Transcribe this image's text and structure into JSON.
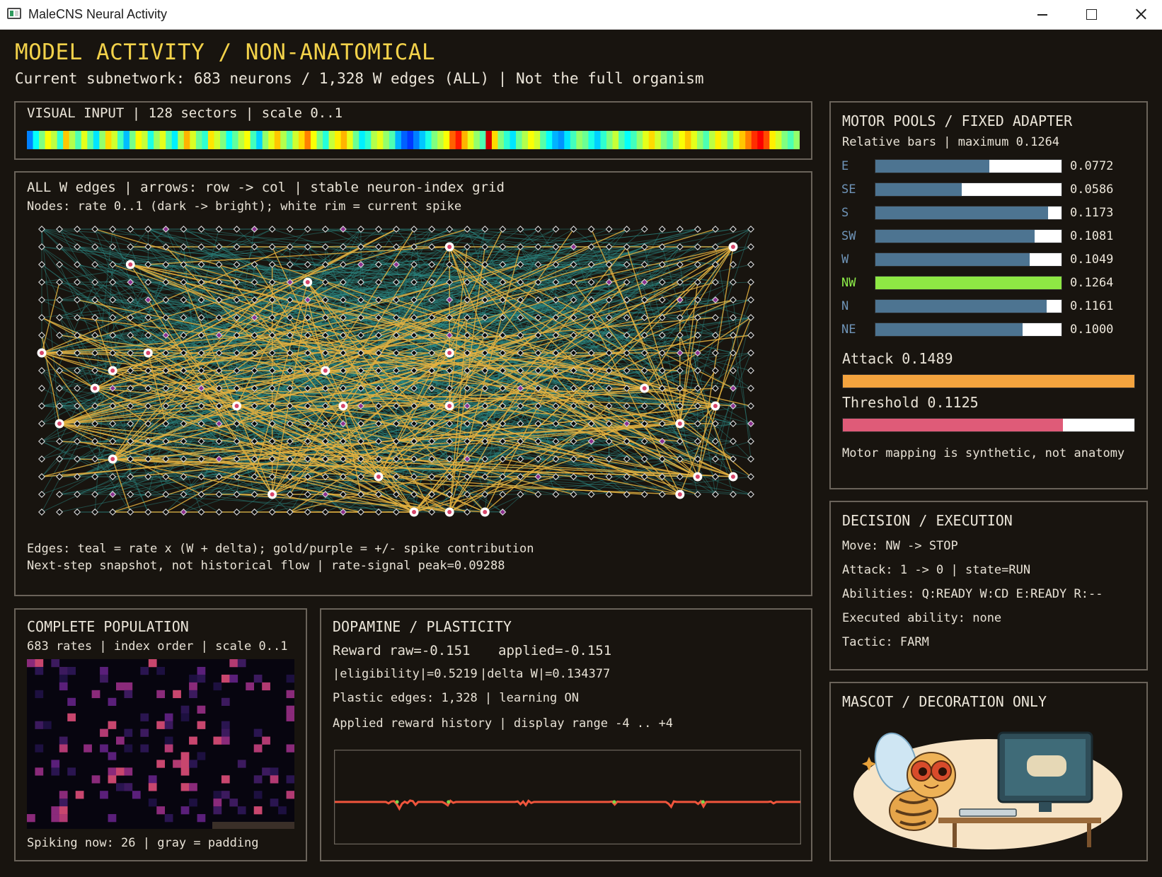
{
  "window": {
    "title": "MaleCNS Neural Activity"
  },
  "header": {
    "title": "MODEL ACTIVITY / NON-ANATOMICAL",
    "subtitle": "Current subnetwork: 683 neurons / 1,328 W edges (ALL) | Not the full organism"
  },
  "visual_input": {
    "title": "VISUAL INPUT | 128 sectors | scale 0..1",
    "sector_values": [
      0.25,
      0.38,
      0.5,
      0.62,
      0.56,
      0.42,
      0.68,
      0.55,
      0.45,
      0.6,
      0.47,
      0.35,
      0.52,
      0.66,
      0.58,
      0.44,
      0.31,
      0.49,
      0.63,
      0.57,
      0.4,
      0.53,
      0.6,
      0.46,
      0.36,
      0.55,
      0.7,
      0.59,
      0.48,
      0.42,
      0.65,
      0.58,
      0.5,
      0.38,
      0.47,
      0.56,
      0.62,
      0.44,
      0.33,
      0.52,
      0.6,
      0.68,
      0.55,
      0.46,
      0.58,
      0.66,
      0.75,
      0.62,
      0.5,
      0.41,
      0.57,
      0.64,
      0.7,
      0.6,
      0.48,
      0.36,
      0.42,
      0.55,
      0.6,
      0.52,
      0.45,
      0.3,
      0.22,
      0.18,
      0.25,
      0.32,
      0.4,
      0.5,
      0.56,
      0.62,
      0.78,
      0.85,
      0.7,
      0.6,
      0.52,
      0.45,
      0.92,
      0.66,
      0.5,
      0.42,
      0.35,
      0.48,
      0.55,
      0.62,
      0.58,
      0.46,
      0.38,
      0.3,
      0.27,
      0.35,
      0.44,
      0.52,
      0.48,
      0.4,
      0.33,
      0.42,
      0.5,
      0.57,
      0.45,
      0.38,
      0.44,
      0.52,
      0.6,
      0.66,
      0.58,
      0.5,
      0.45,
      0.55,
      0.62,
      0.68,
      0.6,
      0.52,
      0.45,
      0.56,
      0.64,
      0.58,
      0.5,
      0.6,
      0.68,
      0.75,
      0.83,
      0.88,
      0.8,
      0.64,
      0.58,
      0.5,
      0.45,
      0.52
    ]
  },
  "graph": {
    "line1": "ALL W edges | arrows: row -> col | stable neuron-index grid",
    "line2": "Nodes: rate 0..1 (dark -> bright); white rim = current spike",
    "footer1": "Edges: teal = rate x (W + delta); gold/purple = +/- spike contribution",
    "footer2": "Next-step snapshot, not historical flow | rate-signal peak=0.09288",
    "edge_colors": {
      "rate": "#2c8f8a",
      "positive_spike": "#e4b23f",
      "negative_spike": "#8c3ea8"
    }
  },
  "population": {
    "title": "COMPLETE POPULATION",
    "subtitle": "683 rates | index order | scale 0..1",
    "footer": "Spiking now: 26 | gray = padding"
  },
  "dopamine": {
    "title": "DOPAMINE / PLASTICITY",
    "reward_raw": "Reward raw=-0.151",
    "reward_applied": "applied=-0.151",
    "eligibility": "|eligibility|=0.5219",
    "delta_w": "|delta W|=0.134377",
    "plastic_edges": "Plastic edges: 1,328 | learning ON",
    "history_label": "Applied reward history | display range -4 .. +4",
    "history_range": [
      -4,
      4
    ],
    "history_values": [
      0.02,
      0.02,
      0.02,
      0.02,
      0.02,
      0.02,
      0.02,
      0.02,
      0.02,
      0.02,
      0.02,
      0.02,
      0.02,
      0.02,
      0.02,
      0.02,
      0.02,
      0.02,
      0.02,
      0.02,
      -0.08,
      0.05,
      0.08,
      -0.12,
      -0.45,
      -0.1,
      0.04,
      -0.06,
      0.12,
      0.08,
      -0.18,
      0.02,
      0.02,
      0.02,
      0.02,
      0.02,
      0.02,
      0.02,
      0.02,
      0.02,
      0.02,
      -0.08,
      -0.22,
      0.1,
      -0.04,
      0.02,
      0.02,
      0.02,
      0.02,
      0.02,
      0.02,
      0.02,
      0.02,
      0.02,
      0.02,
      0.02,
      0.02,
      0.02,
      0.02,
      0.02,
      0.02,
      0.02,
      0.02,
      0.02,
      0.02,
      0.02,
      0.02,
      0.02,
      0.06,
      -0.14,
      0.05,
      -0.2,
      0.1,
      -0.05,
      0.02,
      0.02,
      0.02,
      0.02,
      0.02,
      0.02,
      0.02,
      0.02,
      0.02,
      0.02,
      0.02,
      0.02,
      0.02,
      0.02,
      0.02,
      0.02,
      0.02,
      0.02,
      0.02,
      0.02,
      0.02,
      0.02,
      0.02,
      0.02,
      0.02,
      0.02,
      0.02,
      0.02,
      0.02,
      0.05,
      -0.16,
      0.04,
      0.02,
      0.02,
      0.02,
      0.02,
      0.02,
      0.02,
      0.02,
      0.02,
      0.02,
      0.02,
      0.02,
      0.02,
      0.02,
      0.02,
      0.02,
      0.02,
      0.02,
      0.02,
      -0.1,
      -0.32,
      0.06,
      0.02,
      0.02,
      0.02,
      0.02,
      0.02,
      0.02,
      0.02,
      0.02,
      -0.12,
      0.06,
      -0.3,
      0.02,
      0.02,
      0.02,
      0.02,
      0.02,
      0.02,
      0.02,
      0.02,
      0.02,
      0.02,
      0.02,
      0.02,
      0.02,
      0.02,
      0.02,
      0.02,
      0.02,
      0.02,
      0.02,
      0.02,
      0.02,
      0.02,
      0.02,
      0.02,
      0.05,
      -0.08,
      0.02,
      0.02,
      0.02,
      0.02,
      0.02,
      0.02,
      0.02,
      0.02,
      0.02,
      0.02
    ],
    "line_color": "#f0553c"
  },
  "motor": {
    "title": "MOTOR POOLS / FIXED ADAPTER",
    "subtitle": "Relative bars | maximum 0.1264",
    "max": 0.1264,
    "pools": [
      {
        "label": "E",
        "value": 0.0772,
        "text": "0.0772"
      },
      {
        "label": "SE",
        "value": 0.0586,
        "text": "0.0586"
      },
      {
        "label": "S",
        "value": 0.1173,
        "text": "0.1173"
      },
      {
        "label": "SW",
        "value": 0.1081,
        "text": "0.1081"
      },
      {
        "label": "W",
        "value": 0.1049,
        "text": "0.1049"
      },
      {
        "label": "NW",
        "value": 0.1264,
        "text": "0.1264",
        "active": true
      },
      {
        "label": "N",
        "value": 0.1161,
        "text": "0.1161"
      },
      {
        "label": "NE",
        "value": 0.1,
        "text": "0.1000"
      }
    ],
    "attack_label": "Attack 0.1489",
    "attack_fraction": 1.0,
    "attack_color": "#f3a33e",
    "threshold_label": "Threshold 0.1125",
    "threshold_fraction": 0.755,
    "threshold_color": "#df5b78",
    "note": "Motor mapping is synthetic, not anatomy"
  },
  "decision": {
    "title": "DECISION / EXECUTION",
    "move": "Move: NW -> STOP",
    "attack": "Attack: 1 -> 0 | state=RUN",
    "abilities": "Abilities: Q:READY W:CD E:READY R:--",
    "executed": "Executed ability: none",
    "tactic": "Tactic: FARM"
  },
  "mascot": {
    "title": "MASCOT / DECORATION ONLY"
  }
}
